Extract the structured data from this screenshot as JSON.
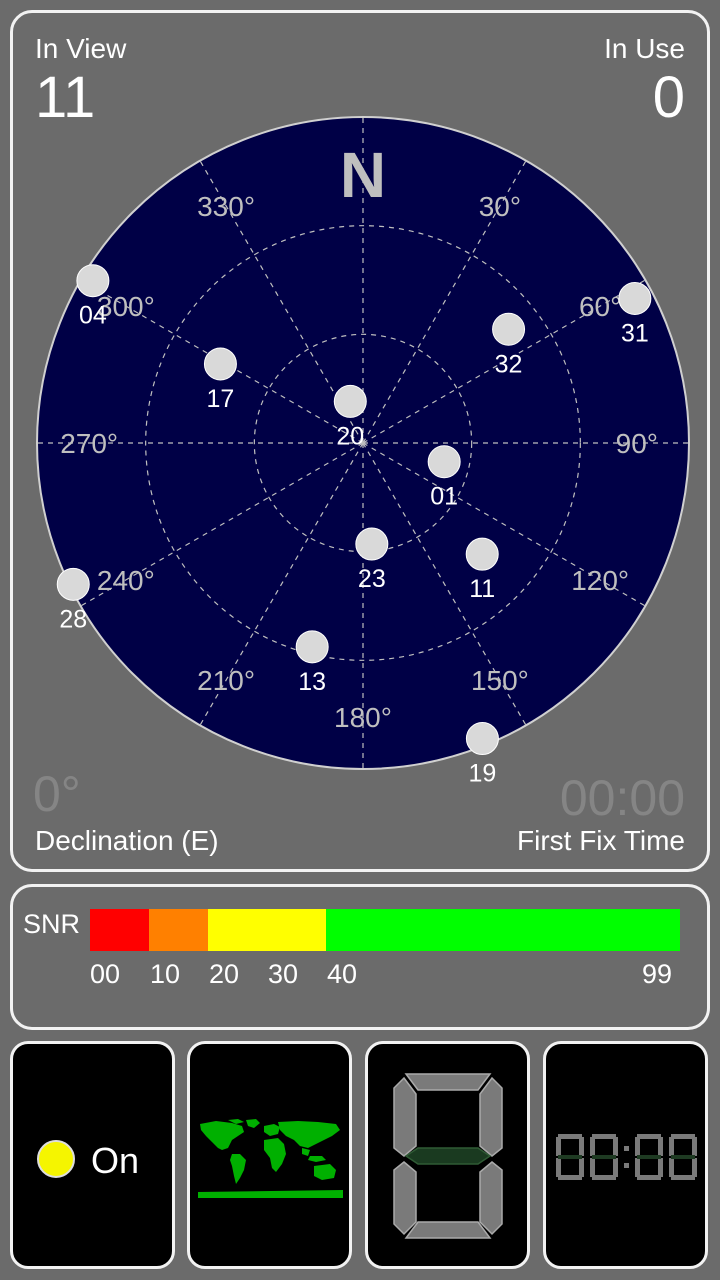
{
  "header": {
    "in_view_label": "In View",
    "in_view_value": "11",
    "in_use_label": "In Use",
    "in_use_value": "0"
  },
  "skyplot": {
    "north_label": "N",
    "bearings": [
      {
        "deg": 30,
        "label": "30°"
      },
      {
        "deg": 60,
        "label": "60°"
      },
      {
        "deg": 90,
        "label": "90°"
      },
      {
        "deg": 120,
        "label": "120°"
      },
      {
        "deg": 150,
        "label": "150°"
      },
      {
        "deg": 180,
        "label": "180°"
      },
      {
        "deg": 210,
        "label": "210°"
      },
      {
        "deg": 240,
        "label": "240°"
      },
      {
        "deg": 270,
        "label": "270°"
      },
      {
        "deg": 300,
        "label": "300°"
      },
      {
        "deg": 330,
        "label": "330°"
      }
    ],
    "satellites": [
      {
        "prn": "04",
        "azimuth": 301,
        "elevation": 3
      },
      {
        "prn": "31",
        "azimuth": 62,
        "elevation": 5
      },
      {
        "prn": "32",
        "azimuth": 52,
        "elevation": 39
      },
      {
        "prn": "17",
        "azimuth": 299,
        "elevation": 45
      },
      {
        "prn": "20",
        "azimuth": 343,
        "elevation": 78
      },
      {
        "prn": "01",
        "azimuth": 103,
        "elevation": 67
      },
      {
        "prn": "23",
        "azimuth": 175,
        "elevation": 62
      },
      {
        "prn": "11",
        "azimuth": 133,
        "elevation": 45
      },
      {
        "prn": "28",
        "azimuth": 244,
        "elevation": 1
      },
      {
        "prn": "13",
        "azimuth": 194,
        "elevation": 32
      },
      {
        "prn": "19",
        "azimuth": 158,
        "elevation": 2
      }
    ]
  },
  "declination": {
    "value": "0°",
    "label": "Declination (E)"
  },
  "first_fix": {
    "value": "00:00",
    "label": "First Fix Time"
  },
  "snr": {
    "label": "SNR",
    "ticks": [
      "00",
      "10",
      "20",
      "30",
      "40",
      "99"
    ],
    "segments": [
      {
        "color": "#ff0000",
        "fraction": 0.1
      },
      {
        "color": "#ff8000",
        "fraction": 0.1
      },
      {
        "color": "#ffff00",
        "fraction": 0.2
      },
      {
        "color": "#00ff00",
        "fraction": 0.6
      }
    ]
  },
  "tiles": {
    "gps_status": "On",
    "gps_dot_color": "#f5f500",
    "digit_value": "8",
    "clock_value": "00:00"
  },
  "colors": {
    "sky_fill": "#000046",
    "satellite": "#d9d9d9",
    "grid": "#bfbfbf",
    "map_green": "#00b000"
  }
}
